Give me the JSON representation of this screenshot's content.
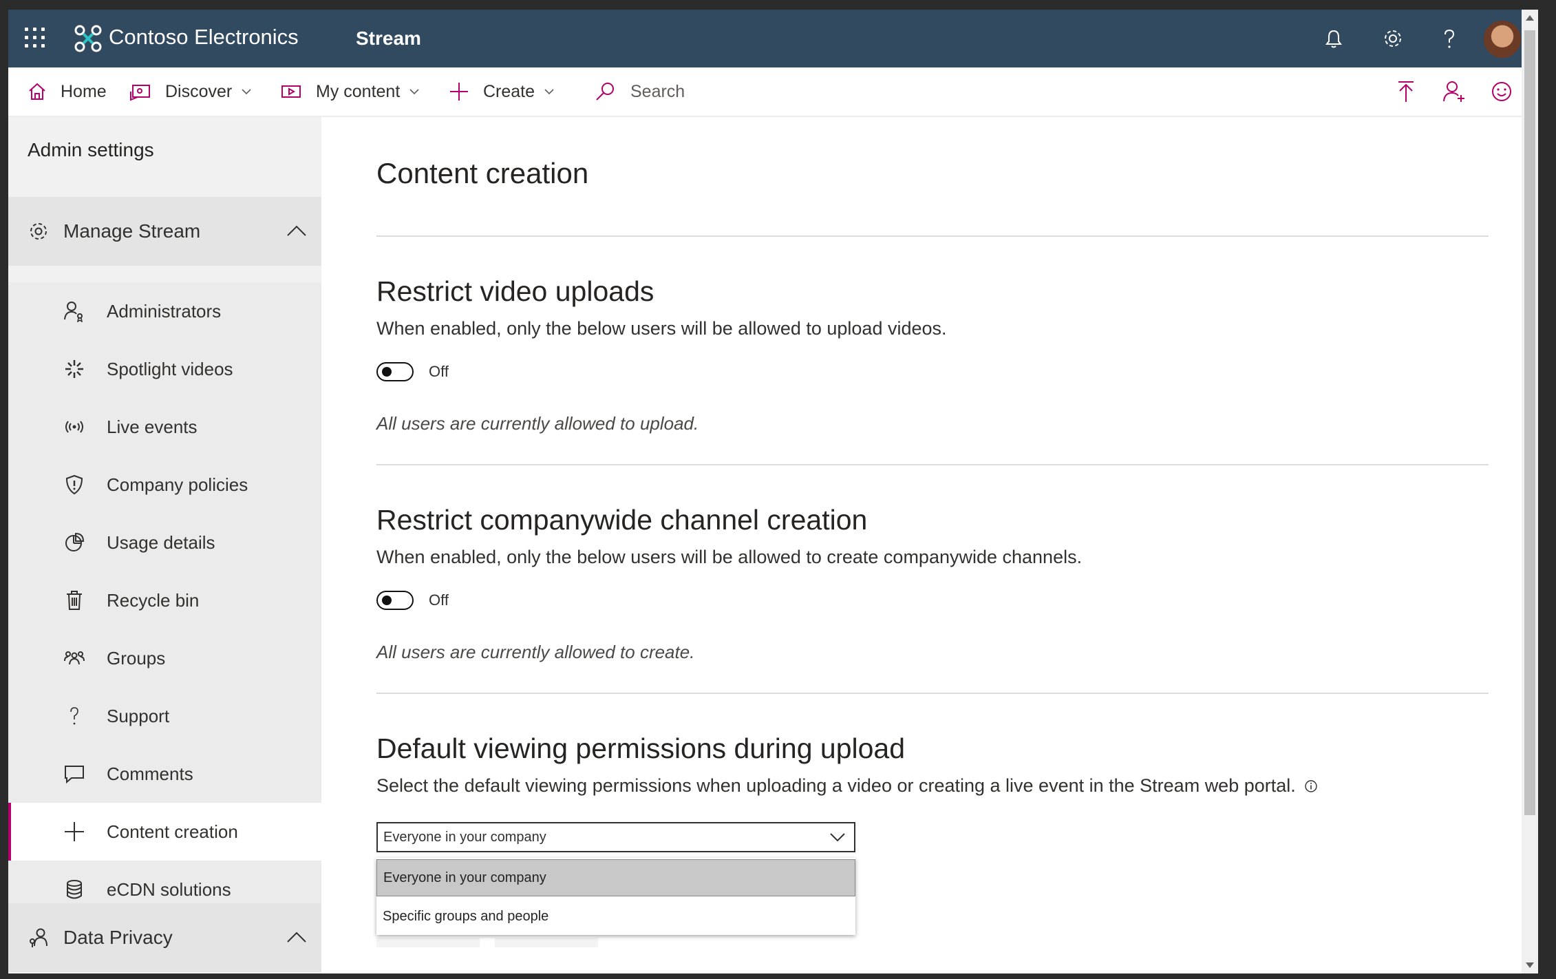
{
  "topbar": {
    "org_name": "Contoso Electronics",
    "app_name": "Stream",
    "icons": [
      "waffle-icon",
      "bell-icon",
      "gear-icon",
      "help-icon"
    ],
    "colors": {
      "background": "#324a5f",
      "text": "#ffffff"
    }
  },
  "nav": {
    "home": "Home",
    "discover": "Discover",
    "my_content": "My content",
    "create": "Create",
    "search_placeholder": "Search",
    "accent": "#b4006b"
  },
  "sidebar": {
    "title": "Admin settings",
    "manage_stream": "Manage Stream",
    "items": [
      {
        "label": "Administrators",
        "icon": "admin-icon"
      },
      {
        "label": "Spotlight videos",
        "icon": "spotlight-icon"
      },
      {
        "label": "Live events",
        "icon": "live-events-icon"
      },
      {
        "label": "Company policies",
        "icon": "shield-icon"
      },
      {
        "label": "Usage details",
        "icon": "pie-chart-icon"
      },
      {
        "label": "Recycle bin",
        "icon": "trash-icon"
      },
      {
        "label": "Groups",
        "icon": "groups-icon"
      },
      {
        "label": "Support",
        "icon": "question-icon"
      },
      {
        "label": "Comments",
        "icon": "comment-icon"
      },
      {
        "label": "Content creation",
        "icon": "plus-icon",
        "active": true
      },
      {
        "label": "eCDN solutions",
        "icon": "database-icon"
      }
    ],
    "data_privacy": "Data Privacy"
  },
  "main": {
    "title": "Content creation",
    "sections": [
      {
        "title": "Restrict video uploads",
        "description": "When enabled, only the below users will be allowed to upload videos.",
        "toggle_state": "Off",
        "note": "All users are currently allowed to upload."
      },
      {
        "title": "Restrict companywide channel creation",
        "description": "When enabled, only the below users will be allowed to create companywide channels.",
        "toggle_state": "Off",
        "note": "All users are currently allowed to create."
      },
      {
        "title": "Default viewing permissions during upload",
        "description": "Select the default viewing permissions when uploading a video or creating a live event in the Stream web portal.",
        "select_value": "Everyone in your company",
        "options": [
          "Everyone in your company",
          "Specific groups and people"
        ]
      }
    ]
  }
}
